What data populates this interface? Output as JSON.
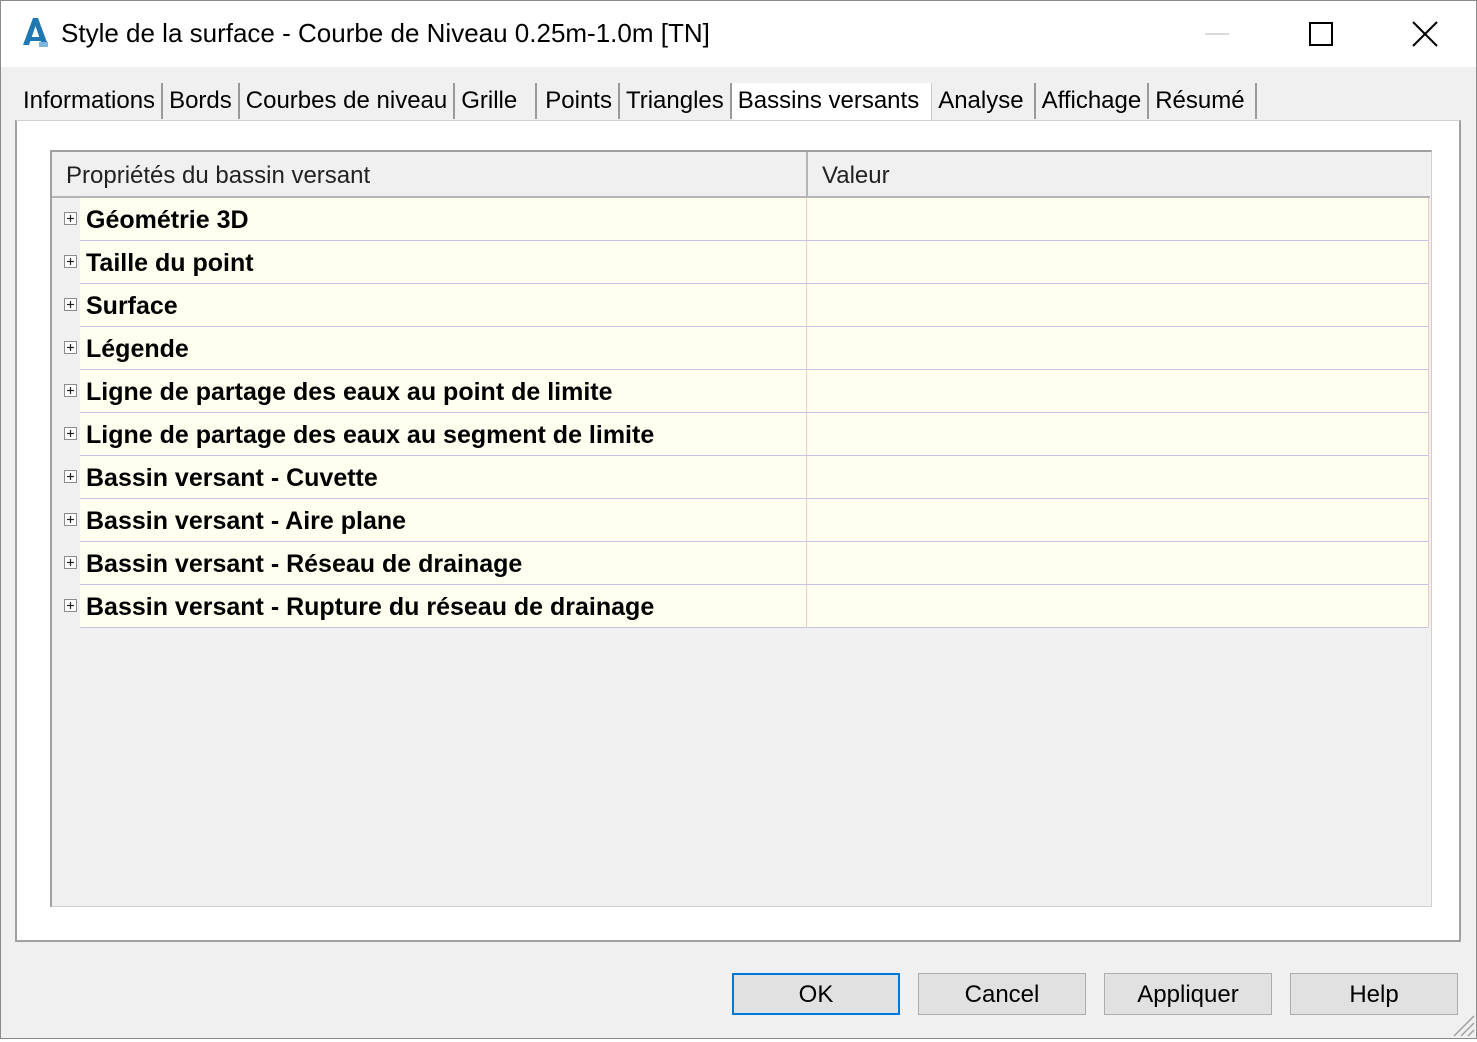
{
  "window": {
    "title": "Style de la surface - Courbe de Niveau 0.25m-1.0m [TN]",
    "app_icon": "autocad-civil3d-icon",
    "accent_color": "#0078d7"
  },
  "tabs": [
    {
      "label": "Informations",
      "active": false
    },
    {
      "label": "Bords",
      "active": false
    },
    {
      "label": "Courbes de niveau",
      "active": false
    },
    {
      "label": "Grille",
      "active": false
    },
    {
      "label": "Points",
      "active": false
    },
    {
      "label": "Triangles",
      "active": false
    },
    {
      "label": "Bassins versants",
      "active": true
    },
    {
      "label": "Analyse",
      "active": false
    },
    {
      "label": "Affichage",
      "active": false
    },
    {
      "label": "Résumé",
      "active": false
    }
  ],
  "grid": {
    "columns": [
      "Propriétés du bassin versant",
      "Valeur"
    ],
    "rows": [
      {
        "name": "Géométrie 3D",
        "value": ""
      },
      {
        "name": "Taille du point",
        "value": ""
      },
      {
        "name": "Surface",
        "value": ""
      },
      {
        "name": "Légende",
        "value": ""
      },
      {
        "name": "Ligne de partage des eaux au point de limite",
        "value": ""
      },
      {
        "name": "Ligne de partage des eaux au segment de limite",
        "value": ""
      },
      {
        "name": "Bassin versant - Cuvette",
        "value": ""
      },
      {
        "name": "Bassin versant - Aire plane",
        "value": ""
      },
      {
        "name": "Bassin versant - Réseau de drainage",
        "value": ""
      },
      {
        "name": "Bassin versant - Rupture du réseau de drainage",
        "value": ""
      }
    ]
  },
  "buttons": {
    "ok": "OK",
    "cancel": "Cancel",
    "apply": "Appliquer",
    "help": "Help"
  }
}
